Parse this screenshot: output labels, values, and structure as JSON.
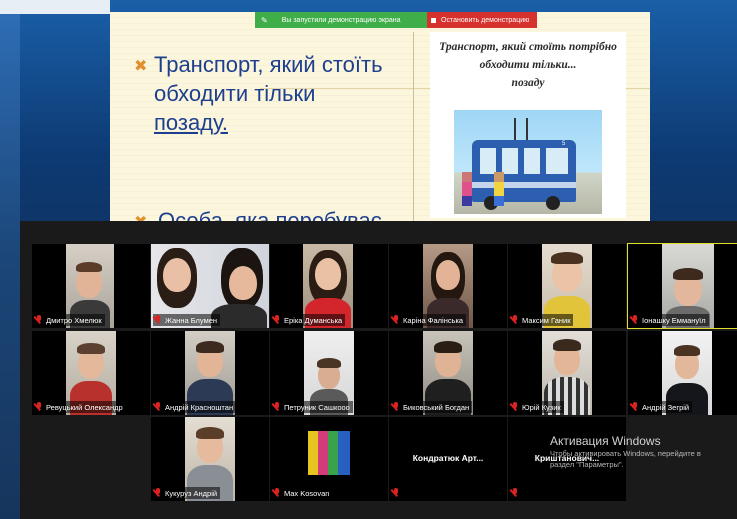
{
  "share": {
    "notice": "Вы запустили демонстрацию экрана",
    "stop_label": "Остановить демонстрацию"
  },
  "slide": {
    "line1": "Транспорт, який стоїть",
    "line2": "обходити тільки",
    "line3": "позаду.",
    "line4": "Особа, яка перебуває",
    "card_title_1": "Транспорт, який стоїть потрібно",
    "card_title_2": "обходити тільки...",
    "card_title_3": "позаду",
    "bus_number": "5"
  },
  "participants": [
    {
      "name": "Дмитро Хмелюк"
    },
    {
      "name": "Жанна Блумен"
    },
    {
      "name": "Еріка Думанська"
    },
    {
      "name": "Каріна Фалінська"
    },
    {
      "name": "Максим Ганик"
    },
    {
      "name": "Іонашку Еммануїл"
    },
    {
      "name": "Ревуцький Олександр"
    },
    {
      "name": "Андрій Красноштан"
    },
    {
      "name": "Петруник Сашкоoo"
    },
    {
      "name": "Биковський Богдан"
    },
    {
      "name": "Юрій Кузик"
    },
    {
      "name": "Андрій Зегрій"
    },
    {
      "name": "Кукуруз Андрій"
    },
    {
      "name": "Max Kosovan"
    },
    {
      "name": "Кондратюк Арт..."
    },
    {
      "name": "Криштанович..."
    }
  ],
  "activation": {
    "title": "Активация Windows",
    "line1": "Чтобы активировать Windows, перейдите в",
    "line2": "раздел \"Параметры\"."
  },
  "colors": {
    "share_green": "#3fae49",
    "stop_red": "#d6312d",
    "slide_text": "#1d3f8e",
    "active_speaker": "#e0e02a"
  }
}
